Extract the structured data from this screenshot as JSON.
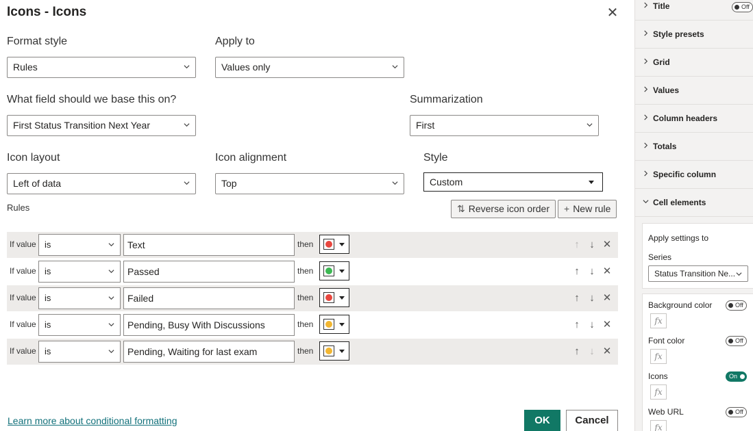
{
  "dialog": {
    "title": "Icons - Icons",
    "format_style": {
      "label": "Format style",
      "value": "Rules"
    },
    "apply_to": {
      "label": "Apply to",
      "value": "Values only"
    },
    "base_field": {
      "label": "What field should we base this on?",
      "value": "First Status Transition Next Year"
    },
    "summarization": {
      "label": "Summarization",
      "value": "First"
    },
    "icon_layout": {
      "label": "Icon layout",
      "value": "Left of data"
    },
    "icon_alignment": {
      "label": "Icon alignment",
      "value": "Top"
    },
    "style": {
      "label": "Style",
      "value": "Custom"
    },
    "rules_label": "Rules",
    "reverse_icon_order": "Reverse icon order",
    "new_rule": "New rule",
    "rules": [
      {
        "if": "If value",
        "op": "is",
        "value": "Text",
        "then": "then",
        "icon_color": "#e8473f"
      },
      {
        "if": "If value",
        "op": "is",
        "value": "Passed",
        "then": "then",
        "icon_color": "#3cb853"
      },
      {
        "if": "If value",
        "op": "is",
        "value": "Failed",
        "then": "then",
        "icon_color": "#e8473f"
      },
      {
        "if": "If value",
        "op": "is",
        "value": "Pending, Busy With Discussions",
        "then": "then",
        "icon_color": "#f2b631"
      },
      {
        "if": "If value",
        "op": "is",
        "value": "Pending, Waiting for last exam",
        "then": "then",
        "icon_color": "#f2b631"
      }
    ],
    "learn_more": "Learn more about conditional formatting",
    "ok": "OK",
    "cancel": "Cancel"
  },
  "pane": {
    "sections": [
      {
        "label": "Title",
        "toggle": "Off"
      },
      {
        "label": "Style presets"
      },
      {
        "label": "Grid"
      },
      {
        "label": "Values"
      },
      {
        "label": "Column headers"
      },
      {
        "label": "Totals"
      },
      {
        "label": "Specific column"
      },
      {
        "label": "Cell elements"
      }
    ],
    "apply_settings_to": "Apply settings to",
    "series_label": "Series",
    "series_value": "Status Transition Ne...",
    "elements": [
      {
        "label": "Background color",
        "toggle": "Off"
      },
      {
        "label": "Font color",
        "toggle": "Off"
      },
      {
        "label": "Icons",
        "toggle": "On"
      },
      {
        "label": "Web URL",
        "toggle": "Off"
      }
    ],
    "fx_label": "fx"
  },
  "colors": {
    "accent": "#117865",
    "link": "#11707a"
  }
}
